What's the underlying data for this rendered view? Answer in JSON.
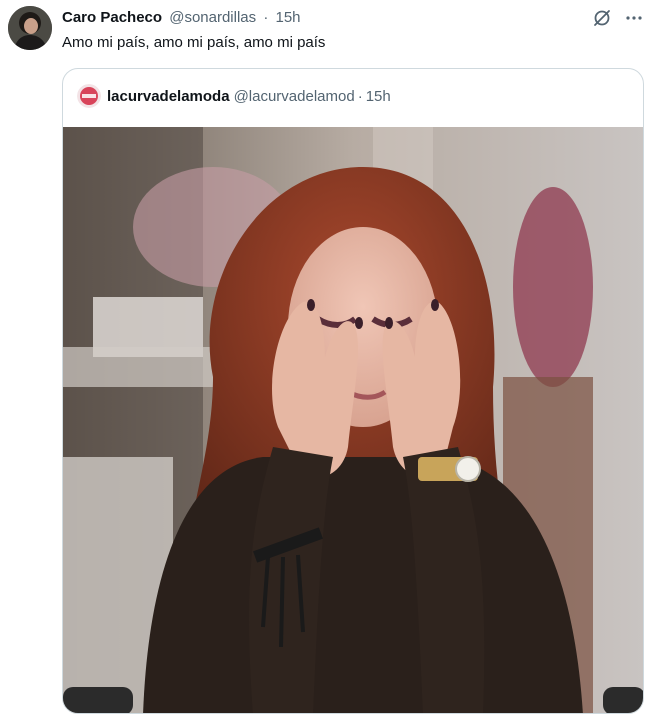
{
  "tweet": {
    "author_name": "Caro Pacheco",
    "author_handle": "@sonardillas",
    "separator": "·",
    "timestamp": "15h",
    "text": "Amo mi país, amo mi país, amo mi país",
    "icons": [
      "grok-icon",
      "more-icon"
    ]
  },
  "quote": {
    "author_name": "lacurvadelamoda",
    "author_handle": "@lacurvadelamod",
    "separator": "·",
    "timestamp": "15h"
  },
  "colors": {
    "text_primary": "#0f1419",
    "text_secondary": "#536471",
    "border": "#cfd9de"
  }
}
